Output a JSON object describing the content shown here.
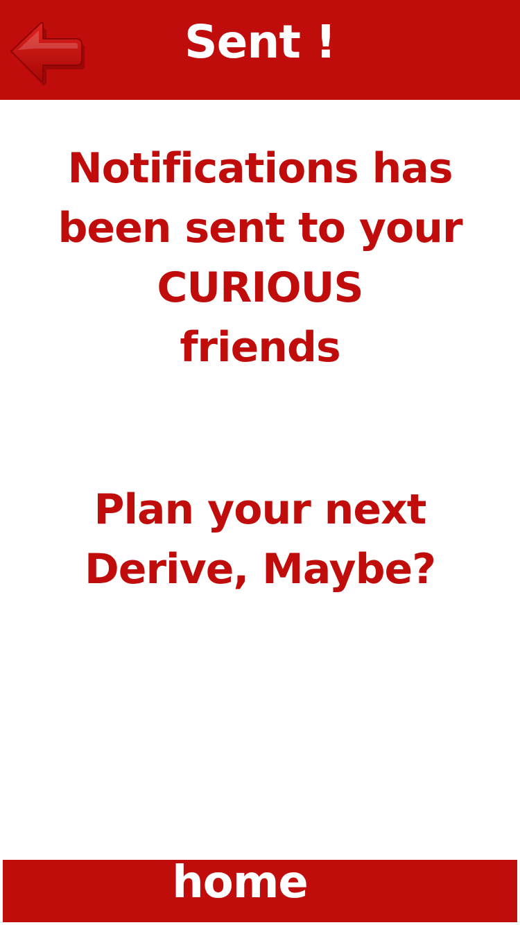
{
  "header": {
    "title": "Sent !",
    "back_icon": "arrow-left-icon",
    "background_color": "#c00d0b"
  },
  "message": {
    "lines": [
      "Notifications has",
      "been sent to your",
      "CURIOUS",
      "friends"
    ],
    "color": "#c00d0b"
  },
  "prompt": {
    "lines": [
      "Plan your next",
      "Derive, Maybe?"
    ]
  },
  "footer": {
    "home_label": "home"
  }
}
